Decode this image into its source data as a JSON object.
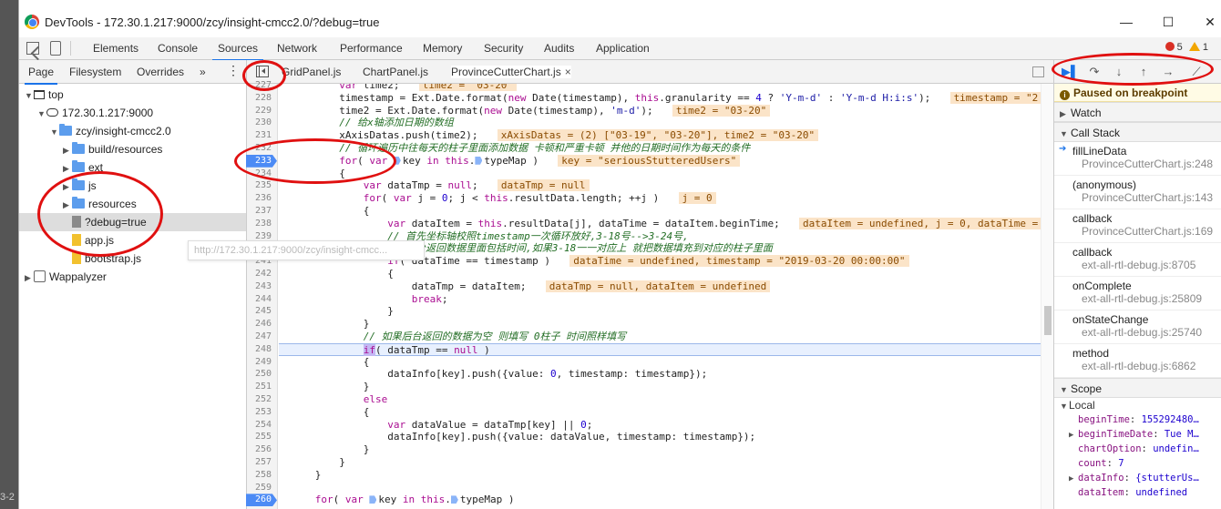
{
  "window": {
    "title": "DevTools - 172.30.1.217:9000/zcy/insight-cmcc2.0/?debug=true"
  },
  "left_edge_text": "3-2",
  "main_tabs": [
    "Elements",
    "Console",
    "Sources",
    "Network",
    "Performance",
    "Memory",
    "Security",
    "Audits",
    "Application"
  ],
  "active_main_tab": "Sources",
  "errors": {
    "errors": "5",
    "warnings": "1"
  },
  "navigator": {
    "tabs": [
      "Page",
      "Filesystem",
      "Overrides"
    ],
    "more": "»",
    "tree": [
      {
        "label": "top",
        "kind": "frame",
        "depth": 0,
        "open": true
      },
      {
        "label": "172.30.1.217:9000",
        "kind": "cloud",
        "depth": 1,
        "open": true
      },
      {
        "label": "zcy/insight-cmcc2.0",
        "kind": "folder",
        "depth": 2,
        "open": true
      },
      {
        "label": "build/resources",
        "kind": "folder",
        "depth": 3,
        "open": false
      },
      {
        "label": "ext",
        "kind": "folder",
        "depth": 3,
        "open": false
      },
      {
        "label": "js",
        "kind": "folder",
        "depth": 3,
        "open": false
      },
      {
        "label": "resources",
        "kind": "folder",
        "depth": 3,
        "open": false
      },
      {
        "label": "?debug=true",
        "kind": "file",
        "depth": 3,
        "open": null,
        "selected": true
      },
      {
        "label": "app.js",
        "kind": "js",
        "depth": 3,
        "open": null
      },
      {
        "label": "bootstrap.js",
        "kind": "js",
        "depth": 3,
        "open": null
      },
      {
        "label": "Wappalyzer",
        "kind": "ext",
        "depth": 0,
        "open": false
      }
    ],
    "hover_url": "http://172.30.1.217:9000/zcy/insight-cmcc..."
  },
  "editor": {
    "tabs": [
      {
        "label": "GridPanel.js",
        "active": false
      },
      {
        "label": "ChartPanel.js",
        "active": false
      },
      {
        "label": "ProvinceCutterChart.js",
        "active": true,
        "close": "×"
      }
    ],
    "lines": [
      {
        "n": "227",
        "html": "          <span class=\"k\">var</span> time2;  <span class=\"iv\">time2 = \"03-20\"</span>"
      },
      {
        "n": "228",
        "html": "          timestamp = Ext.Date.format(<span class=\"k\">new</span> Date(timestamp), <span class=\"k\">this</span>.granularity == <span class=\"n\">4</span> ? <span class=\"s\">'Y-m-d'</span> : <span class=\"s\">'Y-m-d H:i:s'</span>);  <span class=\"iv\">timestamp = \"2</span>"
      },
      {
        "n": "229",
        "html": "          time2 = Ext.Date.format(<span class=\"k\">new</span> Date(timestamp), <span class=\"s\">'m-d'</span>);  <span class=\"iv\">time2 = \"03-20\"</span>"
      },
      {
        "n": "230",
        "html": "          <span class=\"c\">// 给x轴添加日期的数组</span>"
      },
      {
        "n": "231",
        "html": "          xAxisDatas.push(time2);  <span class=\"iv\">xAxisDatas = (2) [\"03-19\", \"03-20\"], time2 = \"03-20\"</span>"
      },
      {
        "n": "232",
        "html": "          <span class=\"c\">// 循环遍历中往每天的柱子里面添加数据 卡顿和严重卡顿 并他的日期时间作为每天的条件</span>"
      },
      {
        "n": "233",
        "html": "          <span class=\"k\">for</span>( <span class=\"k\">var</span> <span class=\"bm\"></span>key <span class=\"k\">in</span> <span class=\"k\">this</span>.<span class=\"bm\"></span>typeMap )  <span class=\"iv\">key = \"seriousStutteredUsers\"</span>",
        "bp": true
      },
      {
        "n": "234",
        "html": "          {"
      },
      {
        "n": "235",
        "html": "              <span class=\"k\">var</span> dataTmp = <span class=\"k\">null</span>;  <span class=\"iv\">dataTmp = null</span>"
      },
      {
        "n": "236",
        "html": "              <span class=\"k\">for</span>( <span class=\"k\">var</span> j = <span class=\"n\">0</span>; j &lt; <span class=\"k\">this</span>.resultData.length; ++j )  <span class=\"iv\">j = 0</span>"
      },
      {
        "n": "237",
        "html": "              {"
      },
      {
        "n": "238",
        "html": "                  <span class=\"k\">var</span> dataItem = <span class=\"k\">this</span>.resultData[j], dataTime = dataItem.beginTime;  <span class=\"iv\">dataItem = undefined, j = 0, dataTime =</span>"
      },
      {
        "n": "239",
        "html": "                  <span class=\"c\">// 首先坐标轴校照timestamp一次循环放好,3-18号--&gt;3-24号,</span>"
      },
      {
        "n": "240",
        "html": "                  <span class=\"c\">// 后台返回数据里面包括时间,如果3-18一一对应上 就把数据填充到对应的柱子里面</span>"
      },
      {
        "n": "241",
        "html": "                  <span class=\"k\">if</span>( dataTime == timestamp )  <span class=\"iv\">dataTime = undefined, timestamp = \"2019-03-20 00:00:00\"</span>"
      },
      {
        "n": "242",
        "html": "                  {"
      },
      {
        "n": "243",
        "html": "                      dataTmp = dataItem;  <span class=\"iv\">dataTmp = null, dataItem = undefined</span>"
      },
      {
        "n": "244",
        "html": "                      <span class=\"k\">break</span>;"
      },
      {
        "n": "245",
        "html": "                  }"
      },
      {
        "n": "246",
        "html": "              }"
      },
      {
        "n": "247",
        "html": "              <span class=\"c\">// 如果后台返回的数据为空 则填写 0柱子 时间照样填写</span>"
      },
      {
        "n": "248",
        "html": "              <span class=\"hl\"><span class=\"k\">if</span></span>( dataTmp == <span class=\"k\">null</span> )",
        "exec": true
      },
      {
        "n": "249",
        "html": "              {"
      },
      {
        "n": "250",
        "html": "                  dataInfo[key].push({value: <span class=\"n\">0</span>, timestamp: timestamp});"
      },
      {
        "n": "251",
        "html": "              }"
      },
      {
        "n": "252",
        "html": "              <span class=\"k\">else</span>"
      },
      {
        "n": "253",
        "html": "              {"
      },
      {
        "n": "254",
        "html": "                  <span class=\"k\">var</span> dataValue = dataTmp[key] || <span class=\"n\">0</span>;"
      },
      {
        "n": "255",
        "html": "                  dataInfo[key].push({value: dataValue, timestamp: timestamp});"
      },
      {
        "n": "256",
        "html": "              }"
      },
      {
        "n": "257",
        "html": "          }"
      },
      {
        "n": "258",
        "html": "      }"
      },
      {
        "n": "259",
        "html": ""
      },
      {
        "n": "260",
        "html": "      <span class=\"k\">for</span>( <span class=\"k\">var</span> <span class=\"bm\"></span>key <span class=\"k\">in</span> <span class=\"k\">this</span>.<span class=\"bm\"></span>typeMap )",
        "bp": true
      }
    ]
  },
  "debugger": {
    "paused_label": "Paused on breakpoint",
    "watch_label": "Watch",
    "callstack_label": "Call Stack",
    "frames": [
      {
        "fn": "fillLineData",
        "loc": "ProvinceCutterChart.js:248",
        "current": true
      },
      {
        "fn": "(anonymous)",
        "loc": "ProvinceCutterChart.js:143"
      },
      {
        "fn": "callback",
        "loc": "ProvinceCutterChart.js:169"
      },
      {
        "fn": "callback",
        "loc": "ext-all-rtl-debug.js:8705"
      },
      {
        "fn": "onComplete",
        "loc": "ext-all-rtl-debug.js:25809"
      },
      {
        "fn": "onStateChange",
        "loc": "ext-all-rtl-debug.js:25740"
      },
      {
        "fn": "method",
        "loc": "ext-all-rtl-debug.js:6862"
      }
    ],
    "scope_label": "Scope",
    "local_label": "Local",
    "scope": [
      {
        "key": "beginTime",
        "val": "155292480…",
        "expand": false
      },
      {
        "key": "beginTimeDate",
        "val": "Tue M…",
        "expand": true
      },
      {
        "key": "chartOption",
        "val": "undefin…",
        "expand": false
      },
      {
        "key": "count",
        "val": "7",
        "expand": false
      },
      {
        "key": "dataInfo",
        "val": "{stutterUs…",
        "expand": true
      },
      {
        "key": "dataItem",
        "val": "undefined",
        "expand": false
      }
    ]
  }
}
